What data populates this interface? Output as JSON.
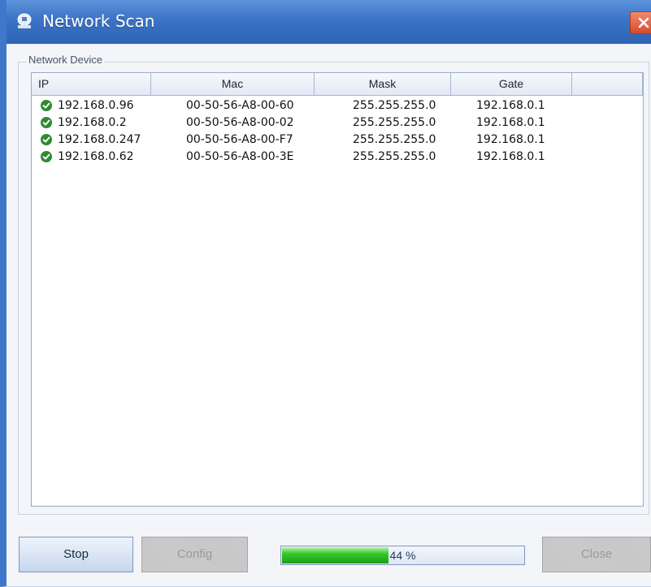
{
  "window": {
    "title": "Network Scan",
    "icon": "network-scan-app-icon",
    "close_icon": "close-icon"
  },
  "group": {
    "label": "Network Device"
  },
  "table": {
    "columns": [
      "IP",
      "Mac",
      "Mask",
      "Gate",
      ""
    ],
    "rows": [
      {
        "status_icon": "check-icon",
        "ip": "192.168.0.96",
        "mac": "00-50-56-A8-00-60",
        "mask": "255.255.255.0",
        "gate": "192.168.0.1"
      },
      {
        "status_icon": "check-icon",
        "ip": "192.168.0.2",
        "mac": "00-50-56-A8-00-02",
        "mask": "255.255.255.0",
        "gate": "192.168.0.1"
      },
      {
        "status_icon": "check-icon",
        "ip": "192.168.0.247",
        "mac": "00-50-56-A8-00-F7",
        "mask": "255.255.255.0",
        "gate": "192.168.0.1"
      },
      {
        "status_icon": "check-icon",
        "ip": "192.168.0.62",
        "mac": "00-50-56-A8-00-3E",
        "mask": "255.255.255.0",
        "gate": "192.168.0.1"
      }
    ]
  },
  "buttons": {
    "stop": "Stop",
    "config": "Config",
    "close": "Close"
  },
  "progress": {
    "value_percent": 44,
    "label": "44 %"
  },
  "colors": {
    "titlebar": "#3b73c6",
    "progress_fill": "#2fbf26",
    "status_ok": "#2e8b2e"
  }
}
